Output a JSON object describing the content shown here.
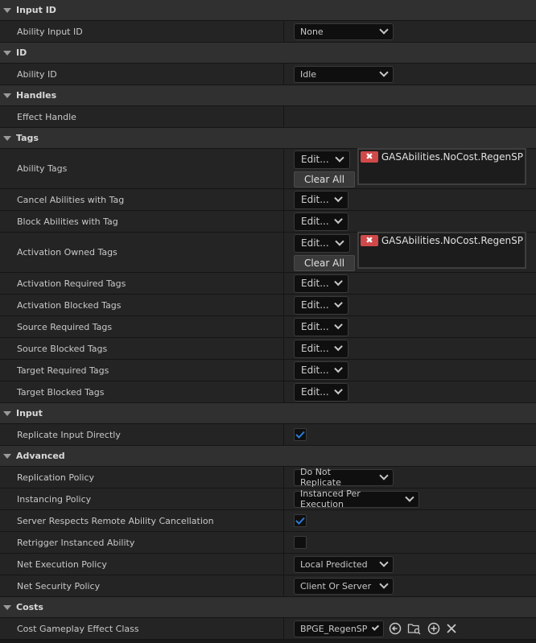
{
  "sections": {
    "input_id": "Input ID",
    "id": "ID",
    "handles": "Handles",
    "tags": "Tags",
    "input": "Input",
    "advanced": "Advanced",
    "costs": "Costs"
  },
  "rows": {
    "ability_input_id": {
      "label": "Ability Input ID",
      "value": "None"
    },
    "ability_id": {
      "label": "Ability ID",
      "value": "Idle"
    },
    "effect_handle": {
      "label": "Effect Handle"
    },
    "ability_tags": {
      "label": "Ability Tags",
      "tag": "GASAbilities.NoCost.RegenSP"
    },
    "cancel_abilities": {
      "label": "Cancel Abilities with Tag"
    },
    "block_abilities": {
      "label": "Block Abilities with Tag"
    },
    "activation_owned": {
      "label": "Activation Owned Tags",
      "tag": "GASAbilities.NoCost.RegenSP"
    },
    "activation_required": {
      "label": "Activation Required Tags"
    },
    "activation_blocked": {
      "label": "Activation Blocked Tags"
    },
    "source_required": {
      "label": "Source Required Tags"
    },
    "source_blocked": {
      "label": "Source Blocked Tags"
    },
    "target_required": {
      "label": "Target Required Tags"
    },
    "target_blocked": {
      "label": "Target Blocked Tags"
    },
    "replicate_input": {
      "label": "Replicate Input Directly",
      "checked": true
    },
    "replication_policy": {
      "label": "Replication Policy",
      "value": "Do Not Replicate"
    },
    "instancing_policy": {
      "label": "Instancing Policy",
      "value": "Instanced Per Execution"
    },
    "server_respects": {
      "label": "Server Respects Remote Ability Cancellation",
      "checked": true
    },
    "retrigger": {
      "label": "Retrigger Instanced Ability",
      "checked": false
    },
    "net_execution": {
      "label": "Net Execution Policy",
      "value": "Local Predicted"
    },
    "net_security": {
      "label": "Net Security Policy",
      "value": "Client Or Server"
    },
    "cost_effect": {
      "label": "Cost Gameplay Effect Class",
      "value": "BPGE_RegenSP"
    }
  },
  "buttons": {
    "edit": "Edit...",
    "clear_all": "Clear All",
    "tag_remove": "✖"
  },
  "colors": {
    "accent_check": "#2d7bd6",
    "tag_remove": "#d0494a"
  },
  "icons": [
    "arrow-left-circle-icon",
    "browse-folder-icon",
    "add-circle-icon",
    "clear-x-icon"
  ]
}
